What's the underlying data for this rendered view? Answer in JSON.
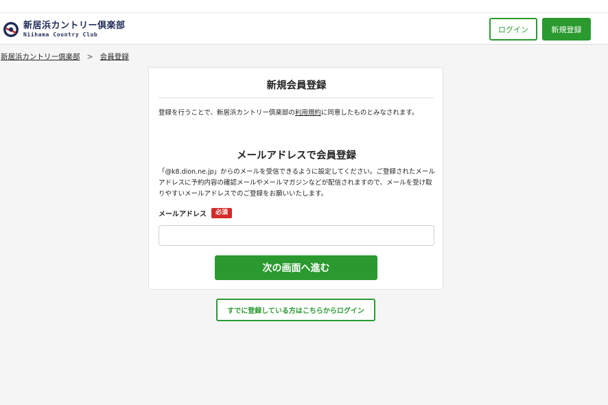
{
  "header": {
    "logo_jp": "新居浜カントリー倶楽部",
    "logo_en": "Niihama Country Club",
    "login_label": "ログイン",
    "register_label": "新規登録"
  },
  "breadcrumb": {
    "home": "新居浜カントリー倶楽部",
    "separator": ">",
    "current": "会員登録"
  },
  "card": {
    "title": "新規会員登録",
    "terms_before": "登録を行うことで、新居浜カントリー倶楽部の",
    "terms_link": "利用規約",
    "terms_after": "に同意したものとみなされます。",
    "section_title": "メールアドレスで会員登録",
    "description": "「@k8.dion.ne.jp」からのメールを受信できるように設定してください。ご登録されたメールアドレスに予約内容の確認メールやメールマガジンなどが配信されますので、メールを受け取りやすいメールアドレスでのご登録をお願いいたします。",
    "email_label": "メールアドレス",
    "required_badge": "必須",
    "email_value": "",
    "next_button": "次の画面へ進む"
  },
  "existing_login_button": "すでに登録している方はこちらからログイン",
  "colors": {
    "brand_green": "#2a9a2f",
    "required_red": "#d42a2a",
    "logo_navy": "#1f2b57"
  },
  "icons": {
    "logo": "club-emblem-icon",
    "separator": "chevron-right-icon"
  }
}
